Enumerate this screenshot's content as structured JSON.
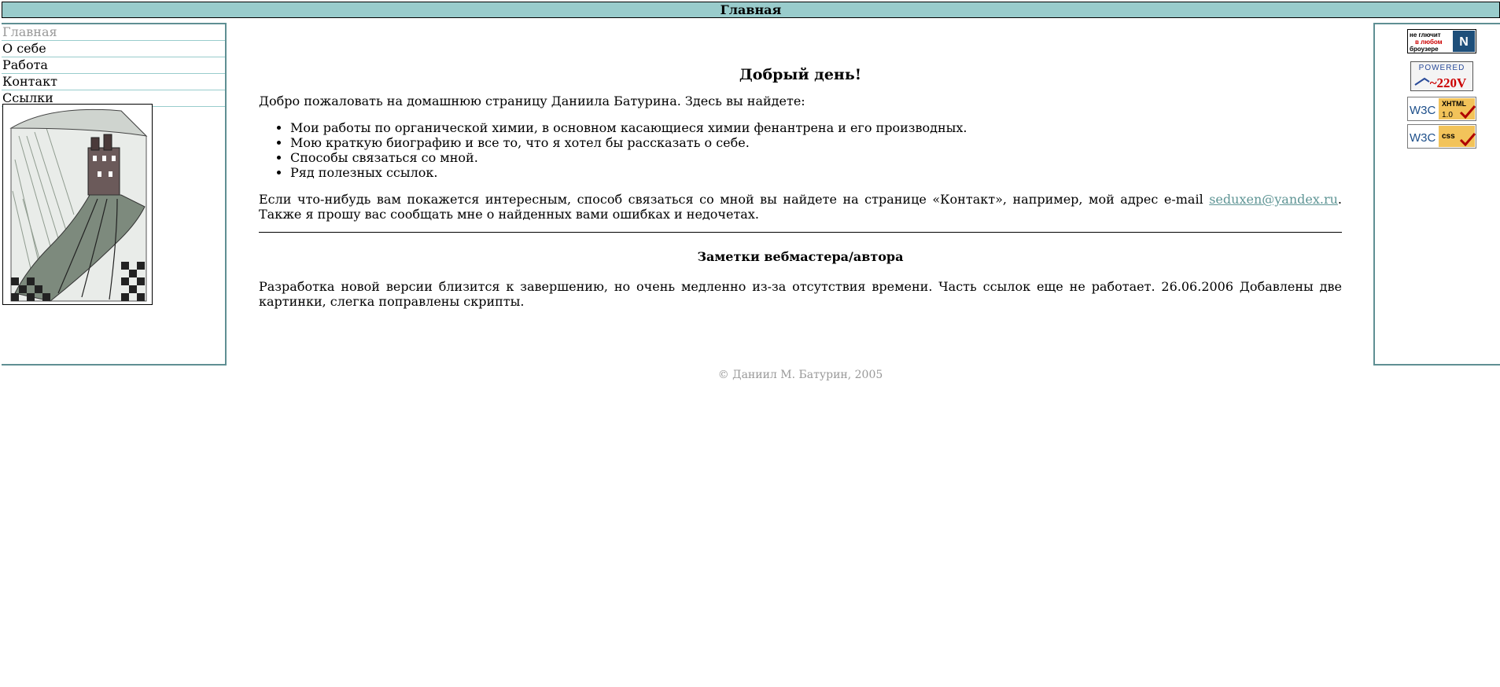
{
  "header": {
    "title": "Главная"
  },
  "nav": {
    "items": [
      {
        "label": "Главная",
        "current": true
      },
      {
        "label": "О себе"
      },
      {
        "label": "Работа"
      },
      {
        "label": "Контакт"
      },
      {
        "label": "Ссылки"
      }
    ]
  },
  "main": {
    "heading": "Добрый день!",
    "intro": "Добро пожаловать на домашнюю страницу Даниила Батурина. Здесь вы найдете:",
    "list": [
      "Мои работы по органической химии, в основном касающиеся химии фенантрена и его производных.",
      "Мою краткую биографию и все то, что я хотел бы рассказать о себе.",
      "Способы связаться со мной.",
      "Ряд полезных ссылок."
    ],
    "contact_text_before": "Если что-нибудь вам покажется интересным, способ связаться со мной вы найдете на странице «Контакт», например, мой адрес e-mail ",
    "email": "seduxen@yandex.ru",
    "contact_text_after": ". Также я прошу вас сообщать мне о найденных вами ошибках и недочетах.",
    "notes_heading": "Заметки вебмастера/автора",
    "notes_text": "Разработка новой версии близится к завершению, но очень медленно из-за отсутствия времени. Часть ссылок еще не работает. 26.06.2006 Добавлены две картинки, слегка поправлены скрипты."
  },
  "badges": {
    "browser": {
      "line1": "не глючит",
      "line2": "в любом",
      "line3": "броузере"
    },
    "powered": {
      "line1": "POWERED",
      "line2": "~220V"
    },
    "xhtml": {
      "w3c": "W3C",
      "name": "XHTML",
      "version": "1.0"
    },
    "css": {
      "w3c": "W3C",
      "name": "css"
    }
  },
  "footer": {
    "copyright": "© Даниил М. Батурин, 2005"
  },
  "colors": {
    "accent": "#99cccc",
    "border": "#5f8f93",
    "link": "#5f9595",
    "muted": "#999999"
  }
}
